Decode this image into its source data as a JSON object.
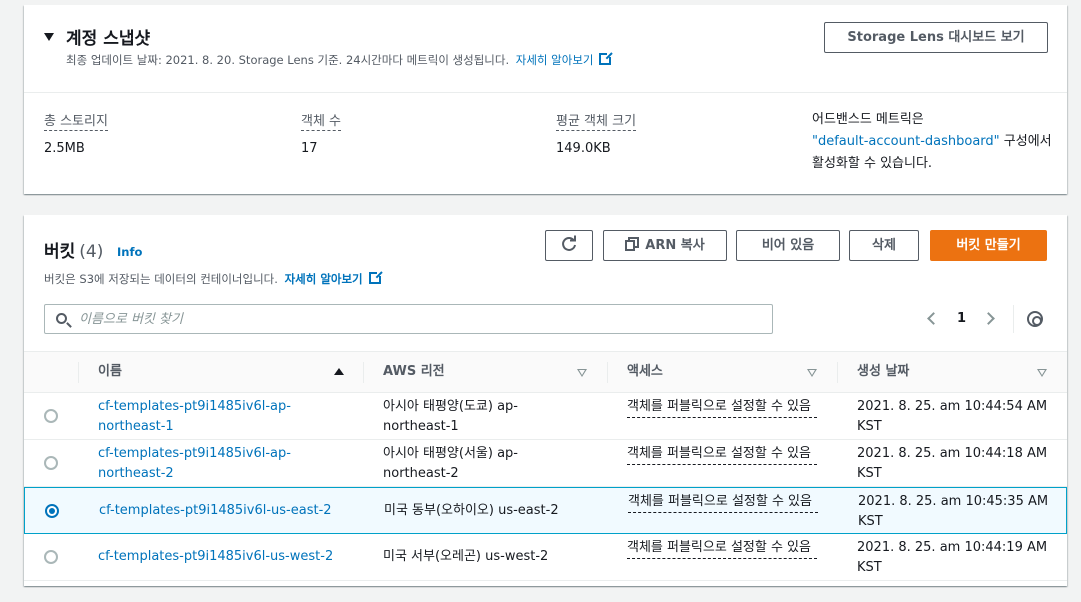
{
  "snapshot": {
    "title": "계정 스냅샷",
    "subtitle": "최종 업데이트 날짜: 2021. 8. 20. Storage Lens 기준. 24시간마다 메트릭이 생성됩니다.",
    "learn_more": "자세히 알아보기",
    "dashboard_button": "Storage Lens 대시보드 보기",
    "metrics": [
      {
        "label": "총 스토리지",
        "value": "2.5MB"
      },
      {
        "label": "객체 수",
        "value": "17"
      },
      {
        "label": "평균 객체 크기",
        "value": "149.0KB"
      }
    ],
    "advanced_prefix": "어드밴스드 메트릭은",
    "advanced_link": "\"default-account-dashboard\"",
    "advanced_suffix": "구성에서 활성화할 수 있습니다."
  },
  "buckets": {
    "title": "버킷",
    "count": "(4)",
    "info": "Info",
    "subtitle": "버킷은 S3에 저장되는 데이터의 컨테이너입니다.",
    "learn_more": "자세히 알아보기",
    "buttons": {
      "copy_arn": "ARN 복사",
      "empty": "비어 있음",
      "delete": "삭제",
      "create": "버킷 만들기"
    },
    "search_placeholder": "이름으로 버킷 찾기",
    "page": "1",
    "columns": [
      "이름",
      "AWS 리전",
      "액세스",
      "생성 날짜"
    ],
    "rows": [
      {
        "name": "cf-templates-pt9i1485iv6l-ap-northeast-1",
        "region": "아시아 태평양(도쿄) ap-northeast-1",
        "access": "객체를 퍼블릭으로 설정할 수 있음",
        "created": "2021. 8. 25. am 10:44:54 AM KST",
        "selected": false
      },
      {
        "name": "cf-templates-pt9i1485iv6l-ap-northeast-2",
        "region": "아시아 태평양(서울) ap-northeast-2",
        "access": "객체를 퍼블릭으로 설정할 수 있음",
        "created": "2021. 8. 25. am 10:44:18 AM KST",
        "selected": false
      },
      {
        "name": "cf-templates-pt9i1485iv6l-us-east-2",
        "region": "미국 동부(오하이오) us-east-2",
        "access": "객체를 퍼블릭으로 설정할 수 있음",
        "created": "2021. 8. 25. am 10:45:35 AM KST",
        "selected": true
      },
      {
        "name": "cf-templates-pt9i1485iv6l-us-west-2",
        "region": "미국 서부(오레곤) us-west-2",
        "access": "객체를 퍼블릭으로 설정할 수 있음",
        "created": "2021. 8. 25. am 10:44:19 AM KST",
        "selected": false
      }
    ]
  },
  "colors": {
    "accent": "#0073bb",
    "primary_button": "#ec7211",
    "selected_row": "#f1faff"
  }
}
